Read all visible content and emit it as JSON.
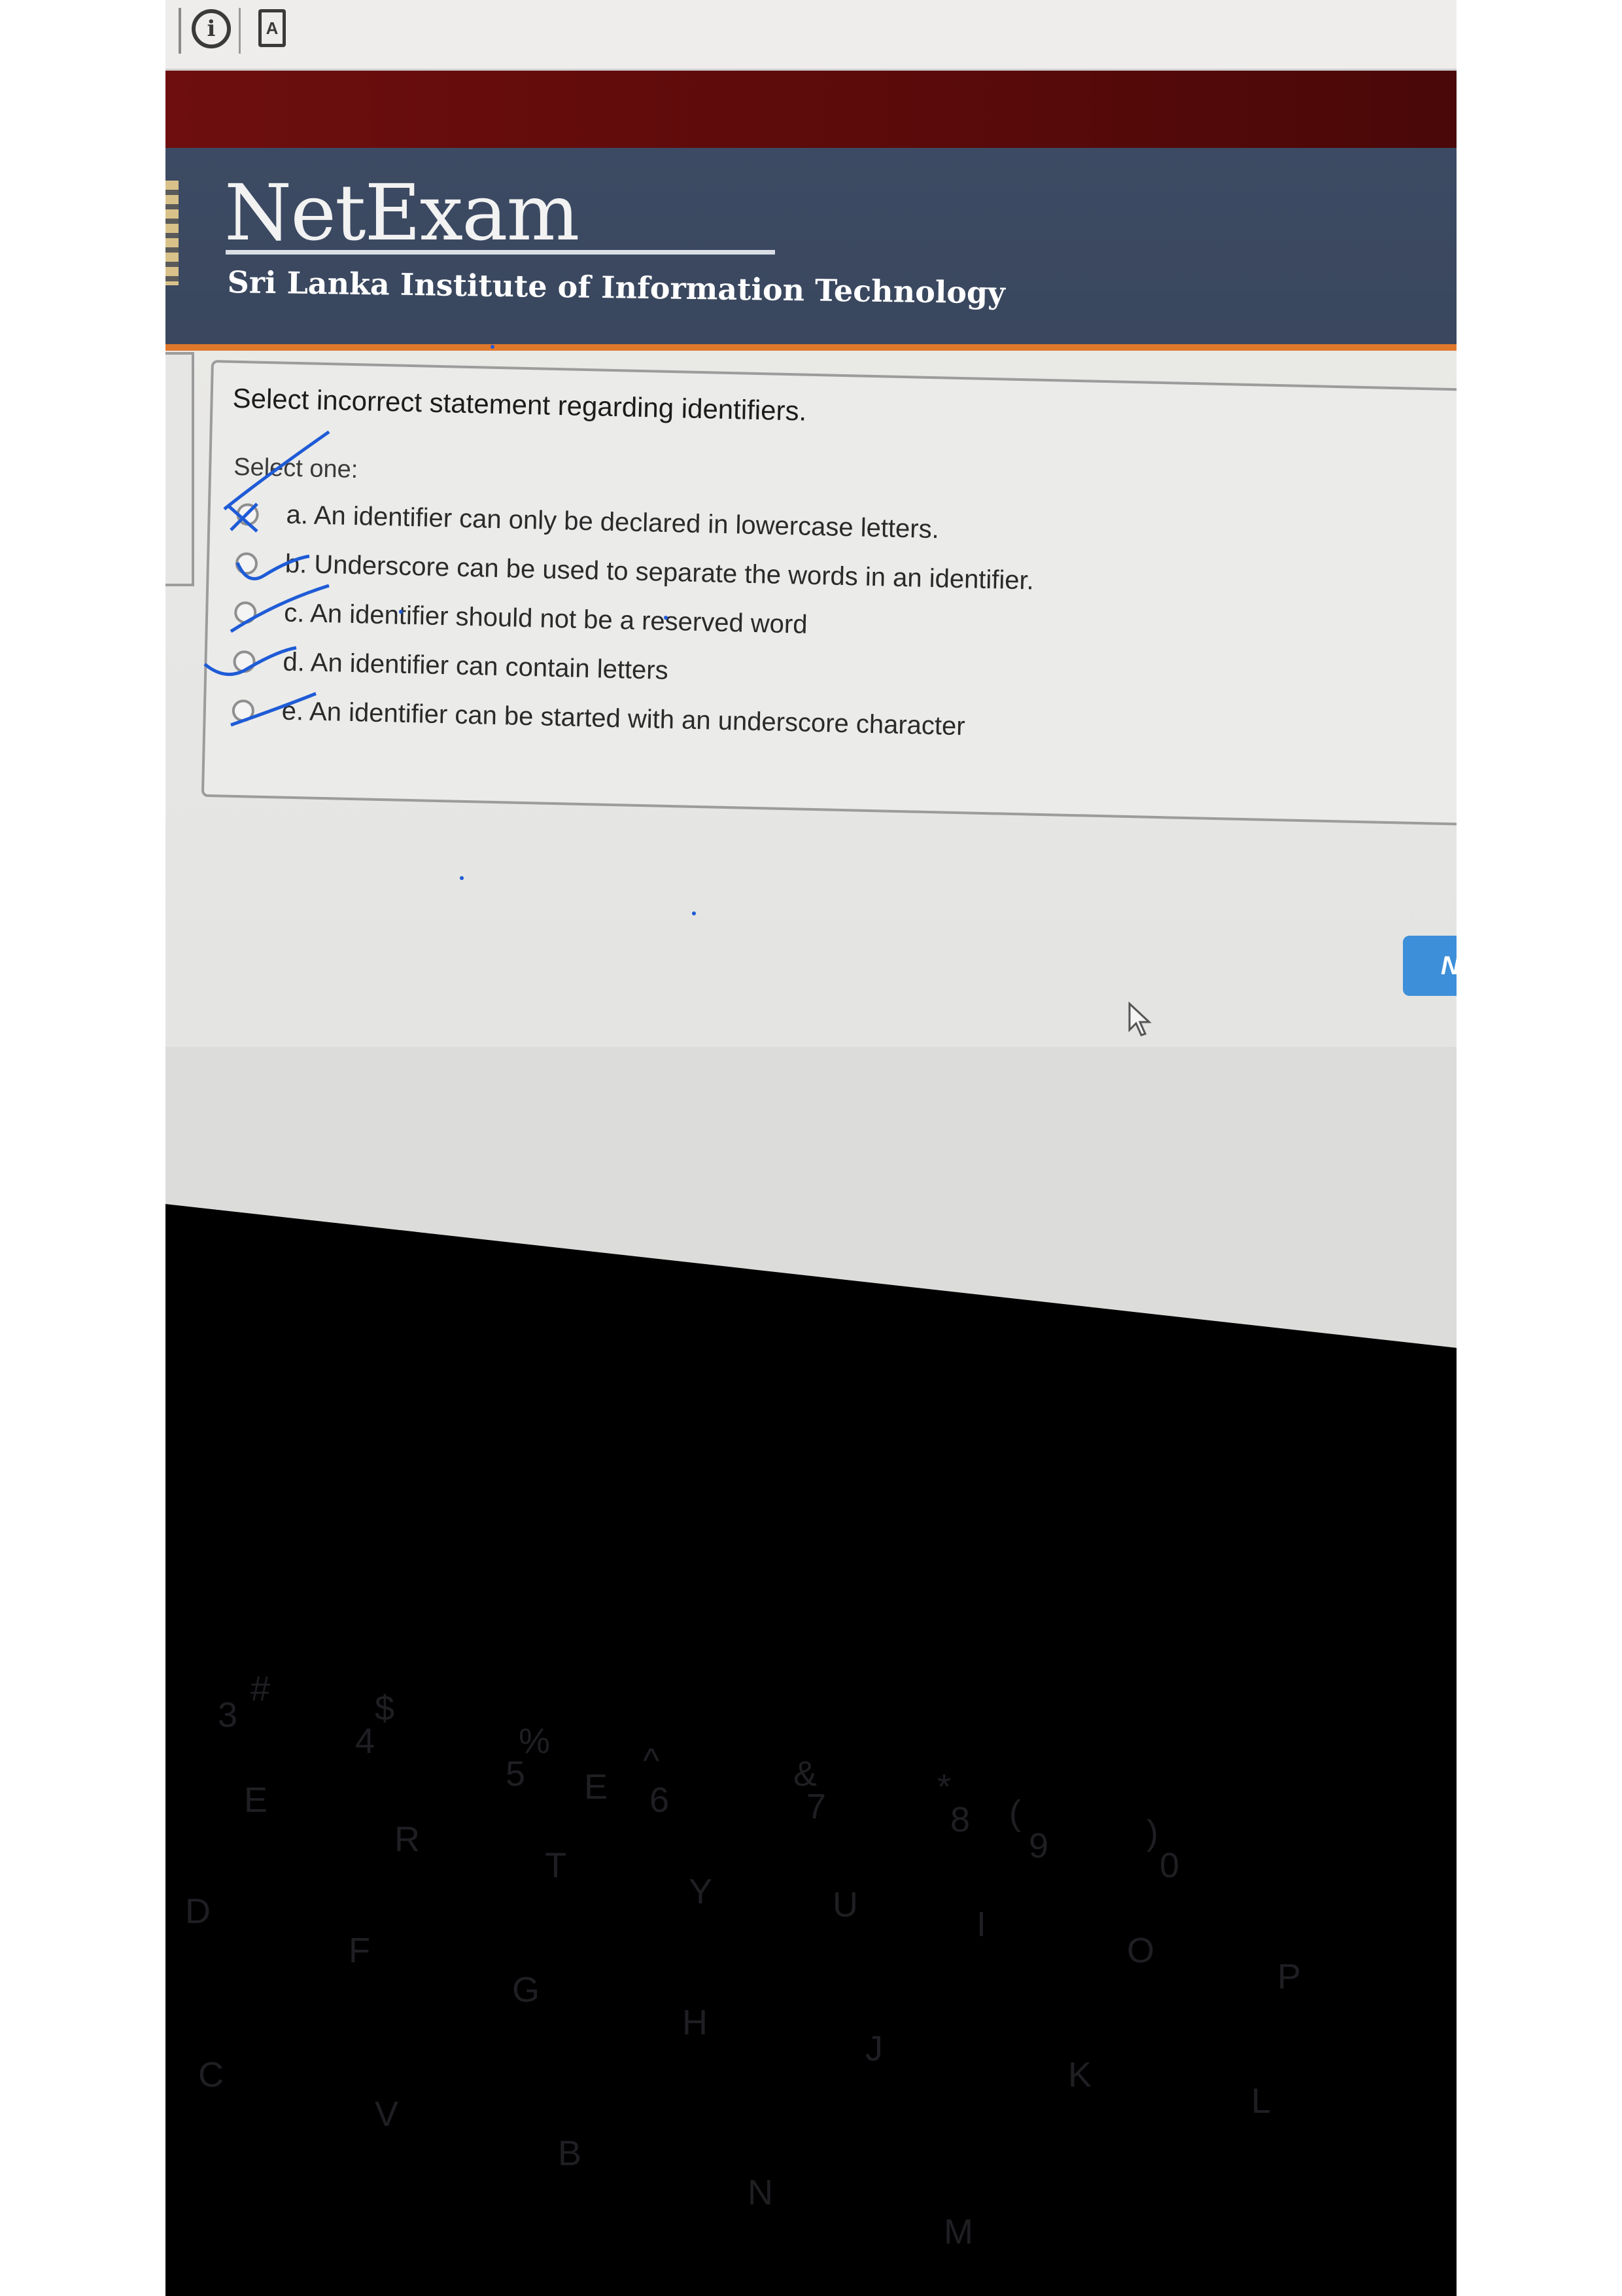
{
  "browser": {
    "info_icon": "info-circle-icon",
    "doc_icon": "pdf-document-icon",
    "doc_icon_glyph": "A"
  },
  "header": {
    "brand": "NetExam",
    "institute": "Sri Lanka Institute of Information Technology"
  },
  "question": {
    "text": "Select incorrect statement regarding identifiers.",
    "prompt": "Select one:",
    "options": [
      {
        "label": "a. An identifier can only be declared in lowercase letters."
      },
      {
        "label": "b. Underscore can be used to separate the words in an identifier."
      },
      {
        "label": "c. An identifier should not be a reserved word"
      },
      {
        "label": "d. An identifier can contain letters"
      },
      {
        "label": "e. An identifier can be started with an underscore character"
      }
    ]
  },
  "navigation": {
    "next_label": "N"
  },
  "keyboard": {
    "keys": [
      "3",
      "#",
      "$",
      "4",
      "%",
      "5",
      "E",
      "^",
      "6",
      "&",
      "7",
      "*",
      "8",
      "(",
      "9",
      ")",
      "0",
      "E",
      "R",
      "T",
      "Y",
      "U",
      "I",
      "O",
      "P",
      "D",
      "F",
      "G",
      "H",
      "J",
      "K",
      "L",
      "C",
      "V",
      "B",
      "N",
      "M"
    ]
  },
  "colors": {
    "header_bg": "#3c4a63",
    "maroon_band": "#5a0a0a",
    "accent_orange": "#e0782b",
    "next_button": "#3d8fd9",
    "ink_blue": "#1e5bd6"
  }
}
